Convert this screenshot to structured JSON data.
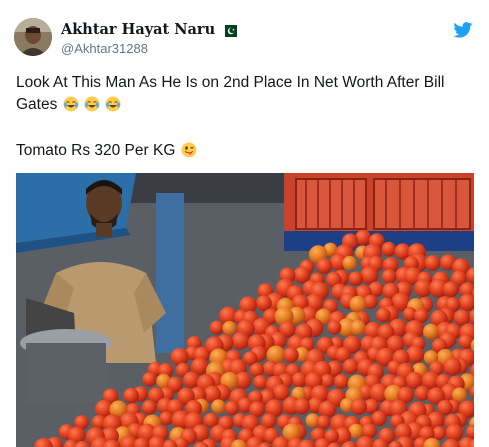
{
  "author": {
    "display_name": "Akhtar Hayat Naru",
    "handle": "@Akhtar31288",
    "flag_icon": "pakistan-flag-icon",
    "avatar_icon": "user-avatar"
  },
  "platform_icon": "twitter-bird-icon",
  "tweet": {
    "line1": "Look At This Man As He Is on 2nd Place In Net Worth After Bill",
    "line2": "Gates",
    "line2_emoji": "tears-of-joy-emoji",
    "line3": "Tomato Rs 320 Per KG",
    "line3_emoji": "winking-tongue-emoji"
  },
  "colors": {
    "twitter_blue": "#1da1f2",
    "text": "#14171a",
    "muted": "#657786",
    "tomato": "#d63a1e"
  }
}
